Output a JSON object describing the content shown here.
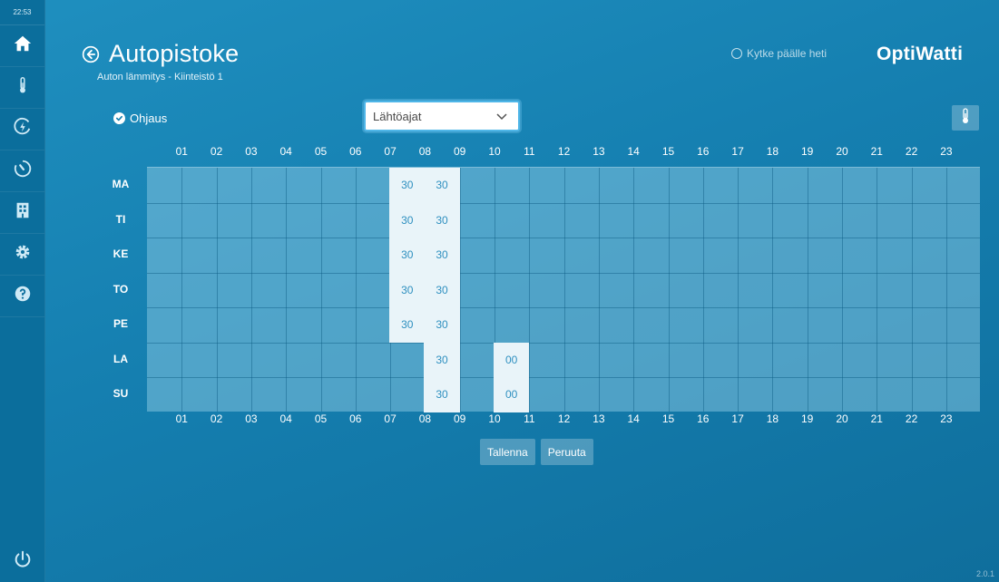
{
  "app": {
    "time": "22:53",
    "title": "Autopistoke",
    "subtitle": "Auton lämmitys - Kiinteistö 1",
    "brand": "OptiWatti",
    "version": "2.0.1",
    "accent_color": "#1f8fbf"
  },
  "sidebar": {
    "items": [
      {
        "icon": "home-icon"
      },
      {
        "icon": "thermometer-icon"
      },
      {
        "icon": "energy-icon"
      },
      {
        "icon": "timer-icon"
      },
      {
        "icon": "building-icon"
      },
      {
        "icon": "gear-icon"
      },
      {
        "icon": "help-icon"
      }
    ],
    "power_icon": "power-icon"
  },
  "header": {
    "quick_toggle_label": "Kytke päälle heti"
  },
  "controls": {
    "control_label": "Ohjaus",
    "mode_select": {
      "selected": "Lähtöajat"
    }
  },
  "schedule": {
    "hours": [
      "01",
      "02",
      "03",
      "04",
      "05",
      "06",
      "07",
      "08",
      "09",
      "10",
      "11",
      "12",
      "13",
      "14",
      "15",
      "16",
      "17",
      "18",
      "19",
      "20",
      "21",
      "22",
      "23"
    ],
    "days": [
      "MA",
      "TI",
      "KE",
      "TO",
      "PE",
      "LA",
      "SU"
    ],
    "entries": [
      {
        "day": "MA",
        "hour": 7,
        "value": "30"
      },
      {
        "day": "MA",
        "hour": 8,
        "value": "30"
      },
      {
        "day": "TI",
        "hour": 7,
        "value": "30"
      },
      {
        "day": "TI",
        "hour": 8,
        "value": "30"
      },
      {
        "day": "KE",
        "hour": 7,
        "value": "30"
      },
      {
        "day": "KE",
        "hour": 8,
        "value": "30"
      },
      {
        "day": "TO",
        "hour": 7,
        "value": "30"
      },
      {
        "day": "TO",
        "hour": 8,
        "value": "30"
      },
      {
        "day": "PE",
        "hour": 7,
        "value": "30"
      },
      {
        "day": "PE",
        "hour": 8,
        "value": "30"
      },
      {
        "day": "LA",
        "hour": 8,
        "value": "30"
      },
      {
        "day": "LA",
        "hour": 10,
        "value": "00"
      },
      {
        "day": "SU",
        "hour": 8,
        "value": "30"
      },
      {
        "day": "SU",
        "hour": 10,
        "value": "00"
      }
    ]
  },
  "actions": {
    "save_label": "Tallenna",
    "cancel_label": "Peruuta"
  }
}
